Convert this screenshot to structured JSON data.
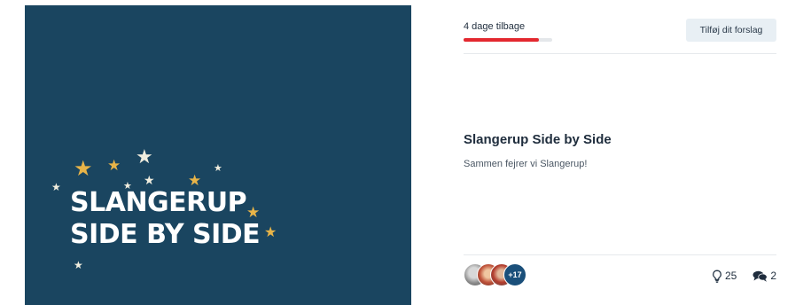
{
  "banner": {
    "title_line1": "SLANGERUP",
    "title_line2": "SIDE BY SIDE"
  },
  "header": {
    "days_left": "4 dage tilbage",
    "progress_fraction": 0.85,
    "suggest_button": "Tilføj dit forslag"
  },
  "main": {
    "title": "Slangerup Side by Side",
    "description": "Sammen fejrer vi Slangerup!"
  },
  "footer": {
    "avatars": [
      "avatar-1",
      "avatar-2",
      "avatar-3"
    ],
    "more_count": "+17",
    "ideas_count": "25",
    "comments_count": "2",
    "icons": {
      "ideas": "lightbulb-icon",
      "comments": "speech-bubbles-icon"
    }
  },
  "colors": {
    "banner_bg": "#1a4560",
    "progress_fill": "#e3282f",
    "button_bg": "#e8eff4",
    "star_gold": "#e8b448",
    "avatar_count_bg": "#1a4f7a"
  }
}
